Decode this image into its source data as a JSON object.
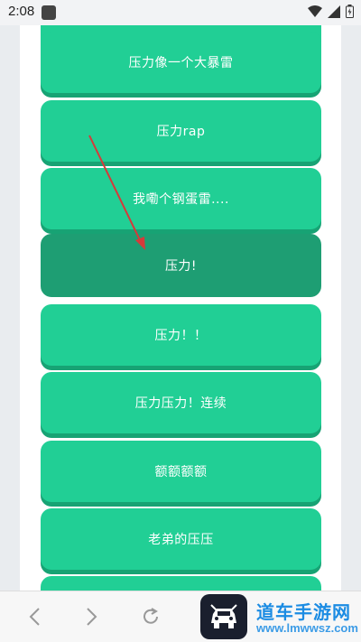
{
  "status_bar": {
    "time": "2:08"
  },
  "buttons": [
    {
      "label": ""
    },
    {
      "label": "压力像一个大暴雷"
    },
    {
      "label": "压力rap"
    },
    {
      "label": "我嘞个钢蛋雷...."
    },
    {
      "label": "压力!"
    },
    {
      "label": "压力！！"
    },
    {
      "label": "压力压力！连续"
    },
    {
      "label": "额额额额"
    },
    {
      "label": "老弟的压压"
    },
    {
      "label": ""
    }
  ],
  "nav": {
    "icons": [
      "back-icon",
      "forward-icon",
      "reload-icon"
    ]
  },
  "watermark": {
    "title": "道车手游网",
    "url": "www.lmwwsz.com"
  },
  "colors": {
    "button": "#21cf95",
    "button_active": "#1e9e73",
    "arrow": "#d63a3a"
  }
}
